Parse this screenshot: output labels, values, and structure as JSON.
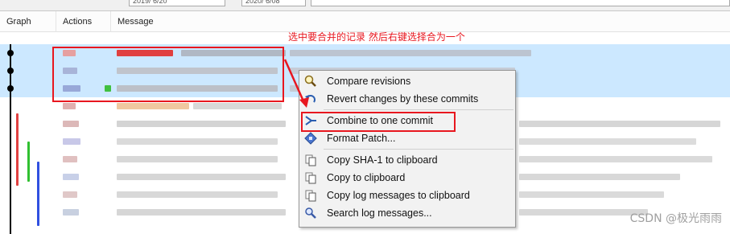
{
  "top_fields": [
    "2019/ 6/20",
    "2020/ 6/08",
    ""
  ],
  "columns": {
    "graph": "Graph",
    "actions": "Actions",
    "message": "Message"
  },
  "annotation": "选中要合并的记录  然后右键选择合为一个",
  "context_menu": {
    "items": [
      {
        "label": "Compare revisions",
        "icon": "magnifier-icon"
      },
      {
        "label": "Revert changes by these commits",
        "icon": "revert-arrow-icon"
      },
      {
        "label": "Combine to one commit",
        "icon": "merge-icon"
      },
      {
        "label": "Format Patch...",
        "icon": "patch-icon"
      },
      {
        "label": "Copy SHA-1 to clipboard",
        "icon": "copy-icon"
      },
      {
        "label": "Copy to clipboard",
        "icon": "copy-icon"
      },
      {
        "label": "Copy log messages to clipboard",
        "icon": "copy-icon"
      },
      {
        "label": "Search log messages...",
        "icon": "search-icon"
      }
    ],
    "highlighted_item": "Combine to one commit"
  },
  "watermark": "CSDN @极光雨雨",
  "colors": {
    "selection": "#cce8ff",
    "annotation_red": "#e8171f",
    "menu_bg": "#f2f2f2"
  }
}
